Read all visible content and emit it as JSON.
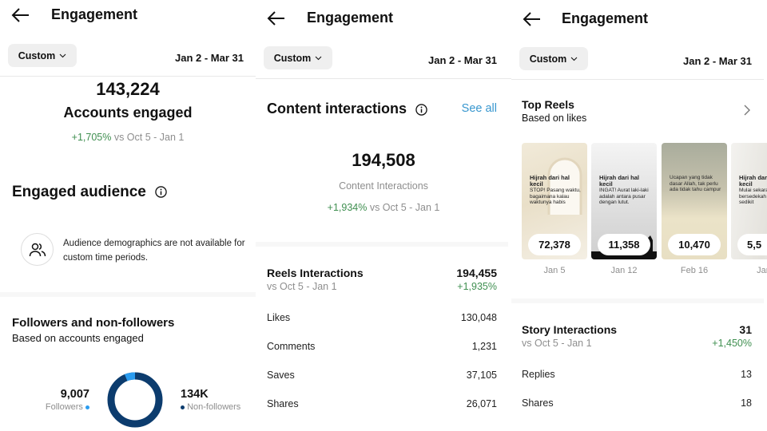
{
  "header": {
    "title": "Engagement",
    "custom_label": "Custom",
    "date_range": "Jan 2 - Mar 31"
  },
  "panel1": {
    "accounts_engaged": {
      "value": "143,224",
      "label": "Accounts engaged",
      "change": "+1,705%",
      "comparison": "vs Oct 5 - Jan 1"
    },
    "engaged_audience": {
      "title": "Engaged audience",
      "notice": "Audience demographics are not available for custom time periods."
    },
    "followers_section": {
      "title": "Followers and non-followers",
      "subtitle": "Based on accounts engaged",
      "followers_value": "9,007",
      "followers_label": "Followers",
      "non_followers_value": "134K",
      "non_followers_label": "Non-followers",
      "colors": {
        "followers": "#2a9cf0",
        "non_followers": "#0c3c6e"
      }
    }
  },
  "panel2": {
    "content_interactions": {
      "title": "Content interactions",
      "see_all": "See all",
      "value": "194,508",
      "label": "Content Interactions",
      "change": "+1,934%",
      "comparison": "vs Oct 5 - Jan 1"
    },
    "reels": {
      "title": "Reels Interactions",
      "comparison": "vs Oct 5 - Jan 1",
      "value": "194,455",
      "change": "+1,935%",
      "rows": [
        {
          "label": "Likes",
          "value": "130,048"
        },
        {
          "label": "Comments",
          "value": "1,231"
        },
        {
          "label": "Saves",
          "value": "37,105"
        },
        {
          "label": "Shares",
          "value": "26,071"
        }
      ]
    }
  },
  "panel3": {
    "top_reels": {
      "title": "Top Reels",
      "subtitle": "Based on likes",
      "items": [
        {
          "count": "72,378",
          "date": "Jan 5",
          "heading": "Hijrah dari hal kecil",
          "body": "STOP! Pasang waktu, bagaimana kalau waktunya habis"
        },
        {
          "count": "11,358",
          "date": "Jan 12",
          "heading": "Hijrah dari hal kecil",
          "body": "INGAT! Aurat laki-laki adalah antara pusar dengan lutut."
        },
        {
          "count": "10,470",
          "date": "Feb 16",
          "heading": "",
          "body": "Ucapan yang tidak dasar Allah, tak perlu ada tidak tahu campur"
        },
        {
          "count": "5,5",
          "date": "Jan",
          "heading": "Hijrah dari hal kecil",
          "body": "Mulai sekarang, bersedekah walau sedikit"
        }
      ]
    },
    "story": {
      "title": "Story Interactions",
      "comparison": "vs Oct 5 - Jan 1",
      "value": "31",
      "change": "+1,450%",
      "rows": [
        {
          "label": "Replies",
          "value": "13"
        },
        {
          "label": "Shares",
          "value": "18"
        }
      ]
    }
  }
}
